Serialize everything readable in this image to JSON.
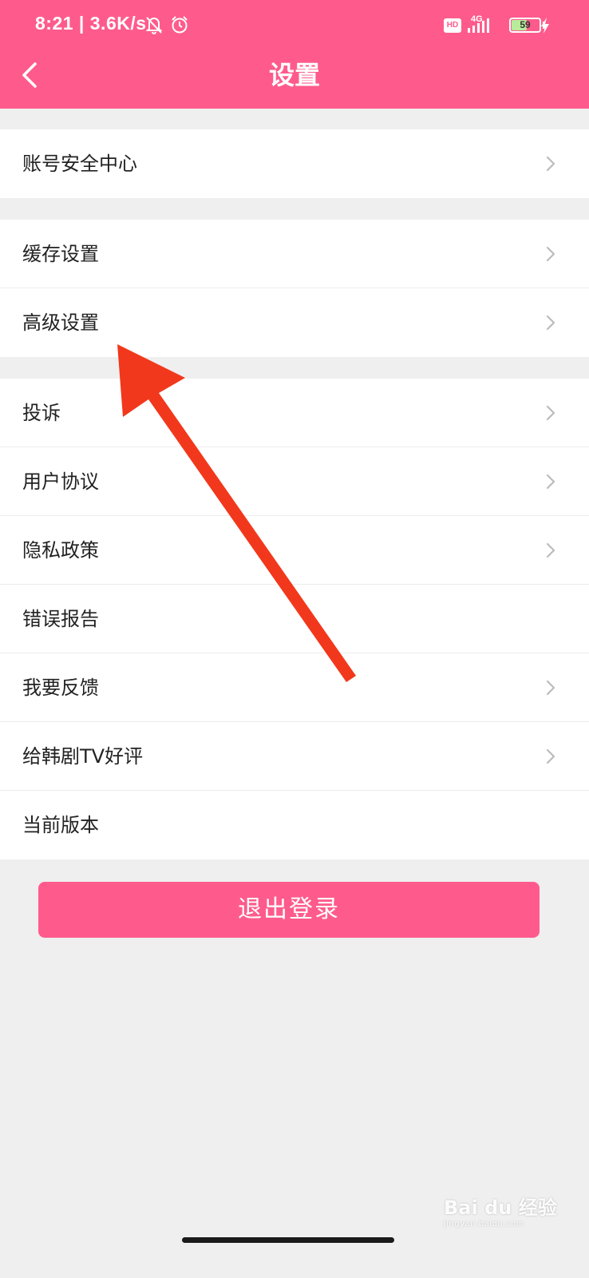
{
  "status_bar": {
    "time": "8:21",
    "network_speed": "3.6K/s",
    "hd_label": "HD",
    "network_type": "4G",
    "battery": "59",
    "battery_level": 0.59
  },
  "header": {
    "title": "设置"
  },
  "groups": [
    {
      "items": [
        {
          "label": "账号安全中心",
          "chevron": true
        }
      ]
    },
    {
      "items": [
        {
          "label": "缓存设置",
          "chevron": true
        },
        {
          "label": "高级设置",
          "chevron": true
        }
      ]
    },
    {
      "items": [
        {
          "label": "投诉",
          "chevron": true
        },
        {
          "label": "用户协议",
          "chevron": true
        },
        {
          "label": "隐私政策",
          "chevron": true
        },
        {
          "label": "错误报告",
          "chevron": false
        },
        {
          "label": "我要反馈",
          "chevron": true
        },
        {
          "label": "给韩剧TV好评",
          "chevron": true
        },
        {
          "label": "当前版本",
          "chevron": false
        }
      ]
    }
  ],
  "logout": {
    "label": "退出登录"
  },
  "watermark": {
    "brand": "Bai du 经验",
    "url": "jingyan.baidu.com"
  },
  "colors": {
    "accent": "#fe5b8c",
    "annotation_arrow": "#f2381c"
  },
  "icons": {
    "back": "chevron-left-icon",
    "row": "chevron-right-icon"
  }
}
